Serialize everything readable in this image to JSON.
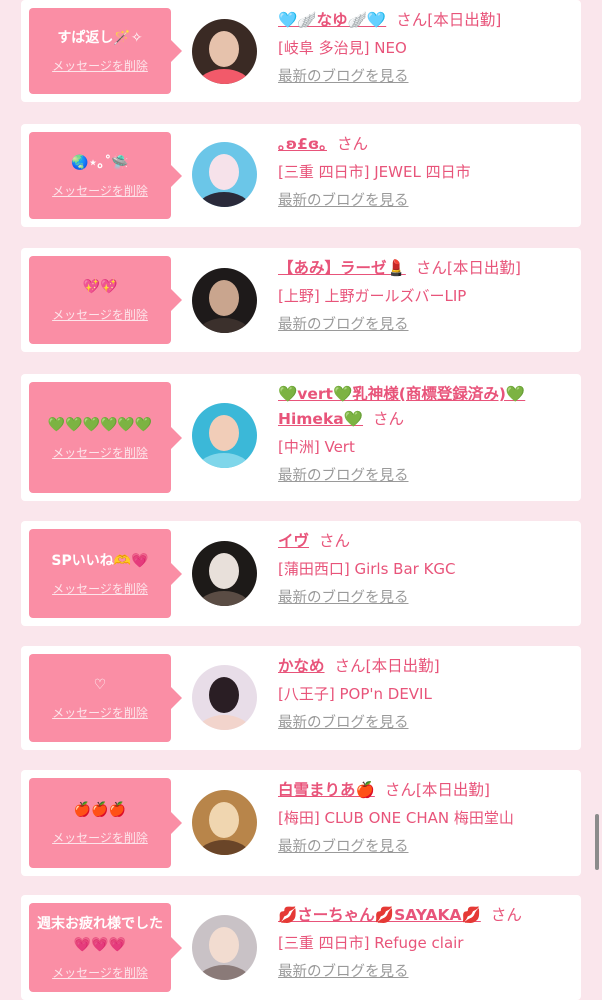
{
  "delete_label": "メッセージを削除",
  "blog_label": "最新のブログを見る",
  "honorific": "さん",
  "theme": {
    "bubble": "#fa8ea5",
    "accent": "#e8547a",
    "card": "#ffffff",
    "bg": "#fae6ec",
    "muted": "#9a9a9a"
  },
  "items": [
    {
      "message": "すぱ返し🪄✧",
      "name": "🩵🪽なゆ🪽🩵",
      "status": "[本日出勤]",
      "shop": "[岐阜 多治見] NEO",
      "avatar_tones": [
        "#3a2a24",
        "#e6c2ac",
        "#f25a6a"
      ]
    },
    {
      "message": "🌏⋆｡˚🛸",
      "name": "｡ʚ£ɞ｡",
      "status": "",
      "shop": "[三重 四日市] JEWEL 四日市",
      "avatar_tones": [
        "#6bc6e8",
        "#f6e2ea",
        "#2a2a3a"
      ]
    },
    {
      "message": "💖💖",
      "name": "【あみ】ラーゼ💄",
      "status": "[本日出勤]",
      "shop": "[上野] 上野ガールズバーLIP",
      "avatar_tones": [
        "#1e1a1a",
        "#c9a58e",
        "#3b302c"
      ]
    },
    {
      "message": "💚💚💚💚💚💚",
      "name": "💚vert💚乳神様(商標登録済み)💚Himeka💚",
      "status": "",
      "shop": "[中洲] Vert",
      "avatar_tones": [
        "#3bb8d8",
        "#f1cdb8",
        "#7fd6ea"
      ]
    },
    {
      "message": "SPいいね🫶💗",
      "name": "イヴ",
      "status": "",
      "shop": "[蒲田西口] Girls Bar KGC",
      "avatar_tones": [
        "#1d1a18",
        "#e8e0da",
        "#5a4c44"
      ]
    },
    {
      "message": "♡",
      "name": "かなめ",
      "status": "[本日出勤]",
      "shop": "[八王子] POP'n DEVIL",
      "avatar_tones": [
        "#e8dde8",
        "#2a1e24",
        "#f2d4cc"
      ]
    },
    {
      "message": "🍎🍎🍎",
      "name": "白雪まりあ🍎",
      "status": "[本日出勤]",
      "shop": "[梅田] CLUB ONE CHAN 梅田堂山",
      "avatar_tones": [
        "#b8854a",
        "#f0d6b0",
        "#6a4528"
      ]
    },
    {
      "message": "週末お疲れ様でした💗💗💗",
      "name": "💋さーちゃん💋SAYAKA💋",
      "status": "",
      "shop": "[三重 四日市] Refuge clair",
      "avatar_tones": [
        "#c9c2c6",
        "#f2dcd0",
        "#8a7a78"
      ]
    }
  ]
}
